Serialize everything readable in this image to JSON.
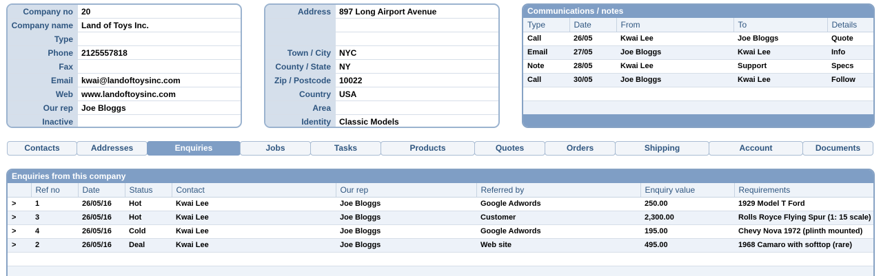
{
  "company": {
    "fields": [
      {
        "label": "Company no",
        "value": "20"
      },
      {
        "label": "Company name",
        "value": "Land of Toys Inc."
      },
      {
        "label": "Type",
        "value": ""
      },
      {
        "label": "Phone",
        "value": "2125557818"
      },
      {
        "label": "Fax",
        "value": ""
      },
      {
        "label": "Email",
        "value": "kwai@landoftoysinc.com"
      },
      {
        "label": "Web",
        "value": "www.landoftoysinc.com"
      },
      {
        "label": "Our rep",
        "value": "Joe Bloggs"
      },
      {
        "label": "Inactive",
        "value": ""
      }
    ]
  },
  "address": {
    "fields": [
      {
        "label": "Address",
        "value": "897 Long Airport Avenue"
      },
      {
        "label": "",
        "value": ""
      },
      {
        "label": "",
        "value": ""
      },
      {
        "label": "Town / City",
        "value": "NYC"
      },
      {
        "label": "County / State",
        "value": "NY"
      },
      {
        "label": "Zip / Postcode",
        "value": "10022"
      },
      {
        "label": "Country",
        "value": "USA"
      },
      {
        "label": "Area",
        "value": ""
      },
      {
        "label": "Identity",
        "value": "Classic Models"
      }
    ]
  },
  "communications": {
    "title": "Communications / notes",
    "columns": [
      "Type",
      "Date",
      "From",
      "To",
      "Details"
    ],
    "rows": [
      [
        "Call",
        "26/05",
        "Kwai Lee",
        "Joe Bloggs",
        "Quote"
      ],
      [
        "Email",
        "27/05",
        "Joe Bloggs",
        "Kwai Lee",
        "Info"
      ],
      [
        "Note",
        "28/05",
        "Kwai Lee",
        "Support",
        "Specs"
      ],
      [
        "Call",
        "30/05",
        "Joe Bloggs",
        "Kwai Lee",
        "Follow"
      ]
    ]
  },
  "tabs": [
    {
      "label": "Contacts",
      "active": false
    },
    {
      "label": "Addresses",
      "active": false
    },
    {
      "label": "Enquiries",
      "active": true
    },
    {
      "label": "Jobs",
      "active": false
    },
    {
      "label": "Tasks",
      "active": false
    },
    {
      "label": "Products",
      "active": false
    },
    {
      "label": "Quotes",
      "active": false
    },
    {
      "label": "Orders",
      "active": false
    },
    {
      "label": "Shipping",
      "active": false
    },
    {
      "label": "Account",
      "active": false
    },
    {
      "label": "Documents",
      "active": false
    }
  ],
  "enquiries": {
    "title": "Enquiries from this company",
    "columns": [
      "",
      "Ref no",
      "Date",
      "Status",
      "Contact",
      "Our rep",
      "Referred by",
      "Enquiry value",
      "Requirements"
    ],
    "rows": [
      [
        ">",
        "1",
        "26/05/16",
        "Hot",
        "Kwai Lee",
        "Joe Bloggs",
        "Google Adwords",
        "250.00",
        "1929 Model T Ford"
      ],
      [
        ">",
        "3",
        "26/05/16",
        "Hot",
        "Kwai Lee",
        "Joe Bloggs",
        "Customer",
        "2,300.00",
        "Rolls Royce Flying Spur (1: 15 scale)"
      ],
      [
        ">",
        "4",
        "26/05/16",
        "Cold",
        "Kwai Lee",
        "Joe Bloggs",
        "Google Adwords",
        "195.00",
        "Chevy Nova 1972 (plinth mounted)"
      ],
      [
        ">",
        "2",
        "26/05/16",
        "Deal",
        "Kwai Lee",
        "Joe Bloggs",
        "Web site",
        "495.00",
        "1968 Camaro with softtop (rare)"
      ]
    ]
  },
  "colors": {
    "accent": "#7f9ec5",
    "label_bg": "#d5dfeb",
    "label_text": "#2f5680"
  }
}
